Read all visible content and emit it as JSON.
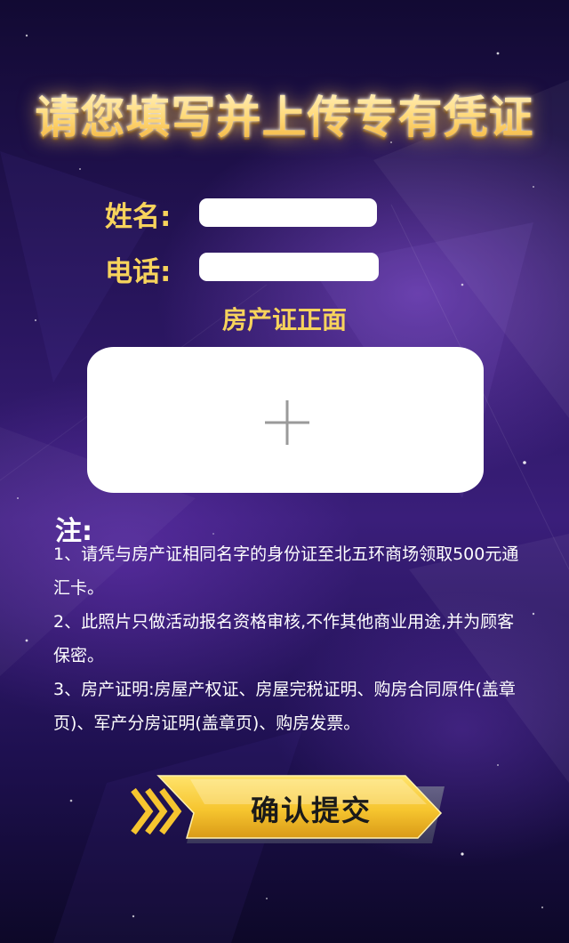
{
  "title": "请您填写并上传专有凭证",
  "form": {
    "name_label": "姓名:",
    "name_value": "",
    "phone_label": "电话:",
    "phone_value": ""
  },
  "upload": {
    "label": "房产证正面",
    "icon": "plus-icon"
  },
  "notes": {
    "title": "注:",
    "items": [
      "1、请凭与房产证相同名字的身份证至北五环商场领取500元通汇卡。",
      "2、此照片只做活动报名资格审核,不作其他商业用途,并为顾客保密。",
      "3、房产证明:房屋产权证、房屋完税证明、购房合同原件(盖章页)、军产分房证明(盖章页)、购房发票。"
    ]
  },
  "submit": {
    "label": "确认提交"
  },
  "colors": {
    "accent_gold": "#f7d35c",
    "button_gold": "#f2c232",
    "background_purple": "#2a1660"
  }
}
